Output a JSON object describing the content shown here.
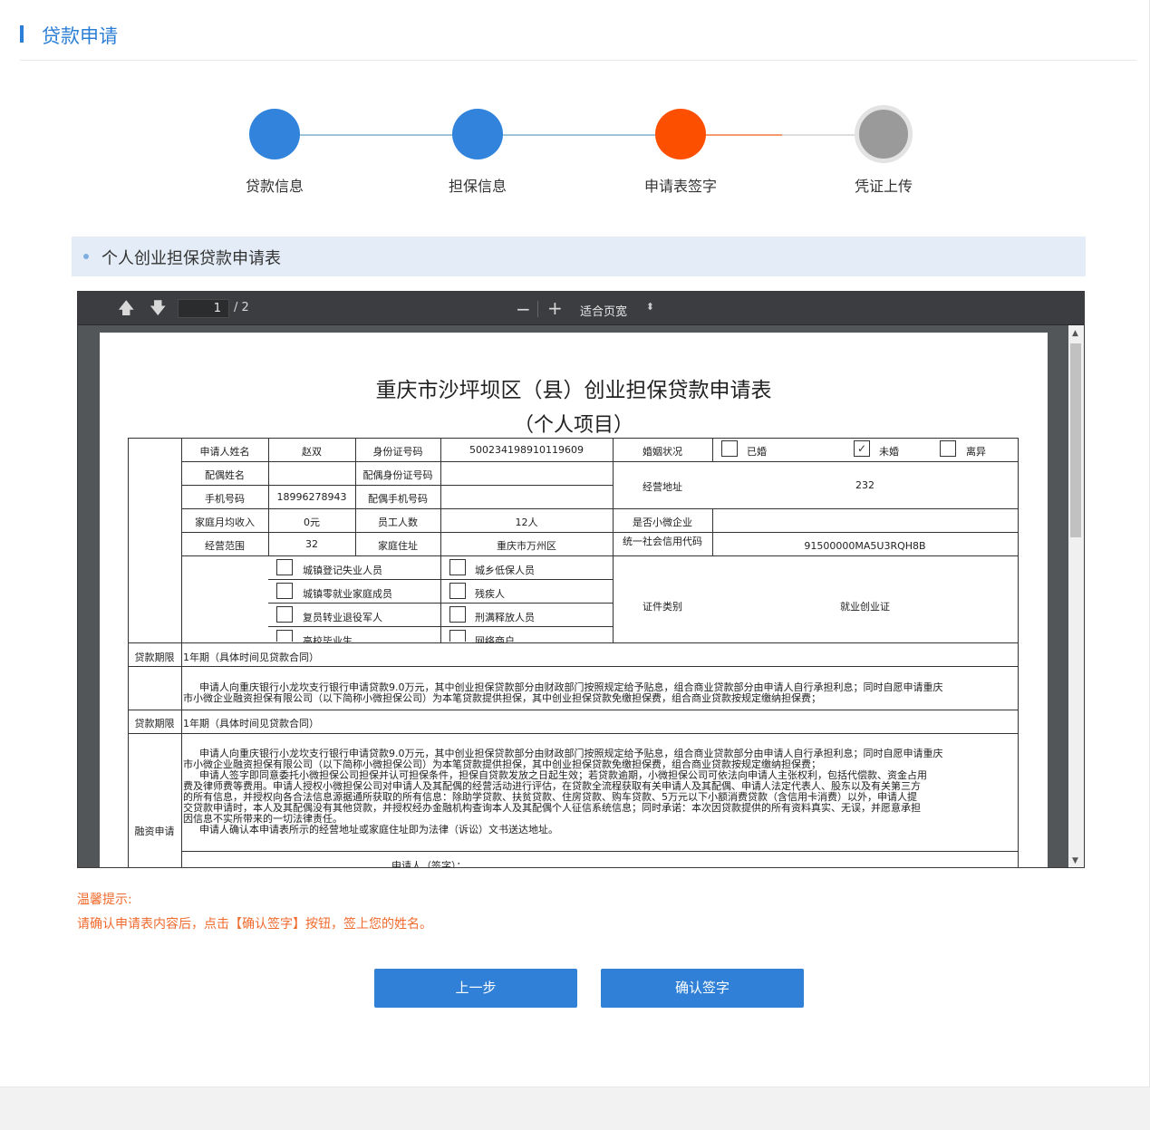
{
  "header": {
    "title": "贷款申请"
  },
  "steps": [
    {
      "label": "贷款信息",
      "status": "done"
    },
    {
      "label": "担保信息",
      "status": "done"
    },
    {
      "label": "申请表签字",
      "status": "current"
    },
    {
      "label": "凭证上传",
      "status": "pending"
    }
  ],
  "colors": {
    "done": "#3183dc",
    "current": "#fd4f00",
    "pending": "#9a9a9a",
    "accent": "#2c7fd6",
    "tip": "#f06a2c"
  },
  "section": {
    "title": "个人创业担保贷款申请表"
  },
  "viewer": {
    "page_current": "1",
    "page_total": "/ 2",
    "zoom": "适合页宽",
    "zoom_minus": "−",
    "zoom_plus": "+"
  },
  "document": {
    "title": "重庆市沙坪坝区（县）创业担保贷款申请表",
    "subtitle": "（个人项目）",
    "rows": {
      "applicant_name_label": "申请人姓名",
      "applicant_name": "赵双",
      "id_label": "身份证号码",
      "id_value": "500234198910119609",
      "marital_label": "婚姻状况",
      "married": "已婚",
      "unmarried": "未婚",
      "divorced": "离异",
      "unmarried_mark": "✓",
      "spouse_name_label": "配偶姓名",
      "spouse_id_label": "配偶身份证号码",
      "biz_address_label": "经营地址",
      "biz_address": "232",
      "phone_label": "手机号码",
      "phone": "18996278943",
      "spouse_phone_label": "配偶手机号码",
      "income_label": "家庭月均收入",
      "income": "0元",
      "staff_label": "员工人数",
      "staff": "12人",
      "micro_label": "是否小微企业",
      "scope_label": "经营范围",
      "scope": "32",
      "home_label": "家庭住址",
      "home": "重庆市万州区",
      "credit_code_label": "统一社会信用代码",
      "credit_code": "91500000MA5U3RQH8B",
      "cat1": "城镇登记失业人员",
      "cat2": "城乡低保人员",
      "cat3": "城镇零就业家庭成员",
      "cat4": "残疾人",
      "cat5": "复员转业退役军人",
      "cat6": "刑满释放人员",
      "cat7": "高校毕业生",
      "cat8": "网络商户",
      "cert_type_label": "证件类别",
      "cert_type": "就业创业证",
      "term_label": "贷款期限",
      "term_value": "1年期（具体时间见贷款合同）",
      "para1_line1": "申请人向重庆银行小龙坎支行银行申请贷款9.0万元，其中创业担保贷款部分由财政部门按照规定给予贴息，组合商业贷款部分由申请人自行承担利息；同时自愿申请重庆",
      "para1_line2": "市小微企业融资担保有限公司（以下简称小微担保公司）为本笔贷款提供担保，其中创业担保贷款免缴担保费，组合商业贷款按规定缴纳担保费；",
      "term_label_2": "贷款期限",
      "term_value_2": "1年期（具体时间见贷款合同）",
      "finance_label": "融资申请",
      "p2_l1": "申请人向重庆银行小龙坎支行银行申请贷款9.0万元，其中创业担保贷款部分由财政部门按照规定给予贴息，组合商业贷款部分由申请人自行承担利息；同时自愿申请重庆",
      "p2_l2": "市小微企业融资担保有限公司（以下简称小微担保公司）为本笔贷款提供担保，其中创业担保贷款免缴担保费，组合商业贷款按规定缴纳担保费；",
      "p2_l3": "申请人签字即同意委托小微担保公司担保并认可担保条件，担保自贷款发放之日起生效；若贷款逾期，小微担保公司可依法向申请人主张权利，包括代偿款、资金占用",
      "p2_l4": "费及律师费等费用。申请人授权小微担保公司对申请人及其配偶的经营活动进行评估，在贷款全流程获取有关申请人及其配偶、申请人法定代表人、股东以及有关第三方",
      "p2_l5": "的所有信息，并授权向各合法信息源据通所获取的所有信息：除助学贷款、扶贫贷款、住房贷款、购车贷款、5万元以下小额消费贷款（含信用卡消费）以外，申请人提",
      "p2_l6": "交贷款申请时，本人及其配偶没有其他贷款，并授权经办金融机构查询本人及其配偶个人征信系统信息；同时承诺：本次因贷款提供的所有资料真实、无误，并愿意承担",
      "p2_l7": "因信息不实所带来的一切法律责任。",
      "p2_l8": "申请人确认本申请表所示的经营地址或家庭住址即为法律（诉讼）文书送达地址。",
      "sign_label": "申请人（签字）："
    }
  },
  "tips": {
    "title": "温馨提示:",
    "text": "请确认申请表内容后，点击【确认签字】按钮，签上您的姓名。"
  },
  "buttons": {
    "prev": "上一步",
    "confirm": "确认签字"
  }
}
